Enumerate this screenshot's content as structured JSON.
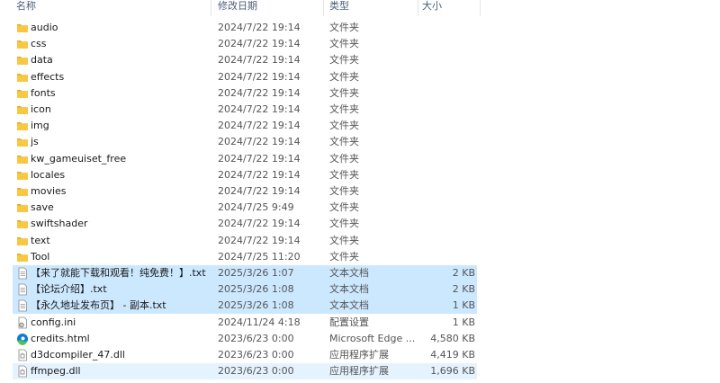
{
  "header": {
    "name": "名称",
    "date": "修改日期",
    "type": "类型",
    "size": "大小"
  },
  "files": [
    {
      "name": "audio",
      "date": "2024/7/22 19:14",
      "type": "文件夹",
      "size": "",
      "icon": "folder-icon",
      "state": ""
    },
    {
      "name": "css",
      "date": "2024/7/22 19:14",
      "type": "文件夹",
      "size": "",
      "icon": "folder-icon",
      "state": ""
    },
    {
      "name": "data",
      "date": "2024/7/22 19:14",
      "type": "文件夹",
      "size": "",
      "icon": "folder-icon",
      "state": ""
    },
    {
      "name": "effects",
      "date": "2024/7/22 19:14",
      "type": "文件夹",
      "size": "",
      "icon": "folder-icon",
      "state": ""
    },
    {
      "name": "fonts",
      "date": "2024/7/22 19:14",
      "type": "文件夹",
      "size": "",
      "icon": "folder-icon",
      "state": ""
    },
    {
      "name": "icon",
      "date": "2024/7/22 19:14",
      "type": "文件夹",
      "size": "",
      "icon": "folder-icon",
      "state": ""
    },
    {
      "name": "img",
      "date": "2024/7/22 19:14",
      "type": "文件夹",
      "size": "",
      "icon": "folder-icon",
      "state": ""
    },
    {
      "name": "js",
      "date": "2024/7/22 19:14",
      "type": "文件夹",
      "size": "",
      "icon": "folder-icon",
      "state": ""
    },
    {
      "name": "kw_gameuiset_free",
      "date": "2024/7/22 19:14",
      "type": "文件夹",
      "size": "",
      "icon": "folder-icon",
      "state": ""
    },
    {
      "name": "locales",
      "date": "2024/7/22 19:14",
      "type": "文件夹",
      "size": "",
      "icon": "folder-icon",
      "state": ""
    },
    {
      "name": "movies",
      "date": "2024/7/22 19:14",
      "type": "文件夹",
      "size": "",
      "icon": "folder-icon",
      "state": ""
    },
    {
      "name": "save",
      "date": "2024/7/25 9:49",
      "type": "文件夹",
      "size": "",
      "icon": "folder-icon",
      "state": ""
    },
    {
      "name": "swiftshader",
      "date": "2024/7/22 19:14",
      "type": "文件夹",
      "size": "",
      "icon": "folder-icon",
      "state": ""
    },
    {
      "name": "text",
      "date": "2024/7/22 19:14",
      "type": "文件夹",
      "size": "",
      "icon": "folder-icon",
      "state": ""
    },
    {
      "name": "Tool",
      "date": "2024/7/25 11:20",
      "type": "文件夹",
      "size": "",
      "icon": "folder-icon",
      "state": ""
    },
    {
      "name": "【来了就能下载和观看！纯免费！】.txt",
      "date": "2025/3/26 1:07",
      "type": "文本文档",
      "size": "2 KB",
      "icon": "text-document-icon",
      "state": "selected"
    },
    {
      "name": "【论坛介绍】.txt",
      "date": "2025/3/26 1:08",
      "type": "文本文档",
      "size": "2 KB",
      "icon": "text-document-icon",
      "state": "selected"
    },
    {
      "name": "【永久地址发布页】 - 副本.txt",
      "date": "2025/3/26 1:08",
      "type": "文本文档",
      "size": "1 KB",
      "icon": "text-document-icon",
      "state": "selected"
    },
    {
      "name": "config.ini",
      "date": "2024/11/24 4:18",
      "type": "配置设置",
      "size": "1 KB",
      "icon": "config-file-icon",
      "state": ""
    },
    {
      "name": "credits.html",
      "date": "2023/6/23 0:00",
      "type": "Microsoft Edge ...",
      "size": "4,580 KB",
      "icon": "edge-icon",
      "state": ""
    },
    {
      "name": "d3dcompiler_47.dll",
      "date": "2023/6/23 0:00",
      "type": "应用程序扩展",
      "size": "4,419 KB",
      "icon": "dll-file-icon",
      "state": ""
    },
    {
      "name": "ffmpeg.dll",
      "date": "2023/6/23 0:00",
      "type": "应用程序扩展",
      "size": "1,696 KB",
      "icon": "dll-file-icon",
      "state": "hover"
    }
  ],
  "colors": {
    "folder": "#f8c845",
    "folder_dark": "#e8ae24",
    "selection": "#cce8ff",
    "hover": "#e5f3ff",
    "header_text": "#4c607a",
    "edge_blue": "#0c7bd6",
    "edge_green": "#4ec74f"
  }
}
